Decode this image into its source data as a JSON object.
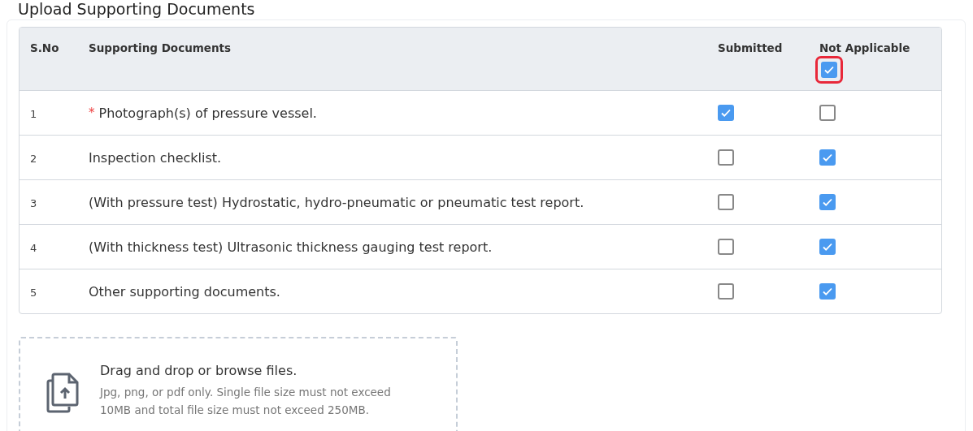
{
  "section_title": "Upload Supporting Documents",
  "table": {
    "columns": [
      "S.No",
      "Supporting Documents",
      "Submitted",
      "Not Applicable"
    ],
    "header_not_applicable": {
      "checked": true,
      "highlighted": true
    },
    "rows": [
      {
        "sno": "1",
        "document": "Photograph(s) of pressure vessel.",
        "required_mark": "*",
        "submitted": true,
        "not_applicable": false
      },
      {
        "sno": "2",
        "document": "Inspection checklist.",
        "submitted": false,
        "not_applicable": true
      },
      {
        "sno": "3",
        "document": "(With pressure test) Hydrostatic, hydro-pneumatic or pneumatic test report.",
        "submitted": false,
        "not_applicable": true
      },
      {
        "sno": "4",
        "document": "(With thickness test) Ultrasonic thickness gauging test report.",
        "submitted": false,
        "not_applicable": true
      },
      {
        "sno": "5",
        "document": "Other supporting documents.",
        "submitted": false,
        "not_applicable": true
      }
    ]
  },
  "dropzone": {
    "title": "Drag and drop or browse files.",
    "hint": "Jpg, png, or pdf only. Single file size must not exceed 10MB and total file size must not exceed 250MB."
  }
}
